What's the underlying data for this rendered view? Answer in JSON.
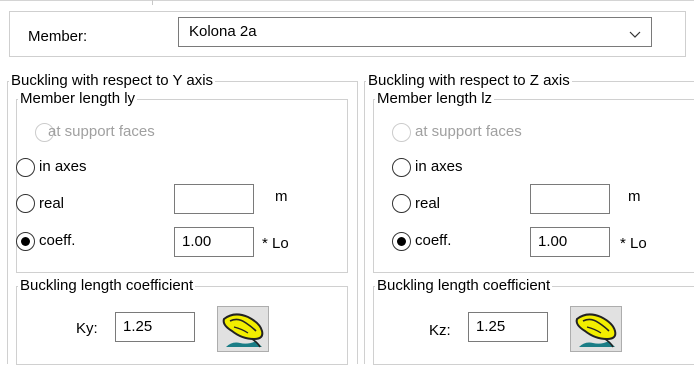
{
  "member": {
    "label": "Member:",
    "value": "Kolona 2a",
    "arrow": "∨"
  },
  "panels": [
    {
      "title": "Buckling with respect to Y axis",
      "length_group": "Member length ly",
      "options": {
        "support_faces": "at support faces",
        "in_axes": "in axes",
        "real": "real",
        "coeff": "coeff."
      },
      "selected_option": "coeff.",
      "real_value": "",
      "real_unit": "m",
      "coeff_value": "1.00",
      "coeff_suffix": "* Lo",
      "coef_group": "Buckling length coefficient",
      "coef_label": "Ky:",
      "coef_value": "1.25",
      "icon": "buckling-shape-icon"
    },
    {
      "title": "Buckling with respect to Z axis",
      "length_group": "Member length lz",
      "options": {
        "support_faces": "at support faces",
        "in_axes": "in axes",
        "real": "real",
        "coeff": "coeff."
      },
      "selected_option": "coeff.",
      "real_value": "",
      "real_unit": "m",
      "coeff_value": "1.00",
      "coeff_suffix": "* Lo",
      "coef_group": "Buckling length coefficient",
      "coef_label": "Kz:",
      "coef_value": "1.25",
      "icon": "buckling-shape-icon"
    }
  ]
}
